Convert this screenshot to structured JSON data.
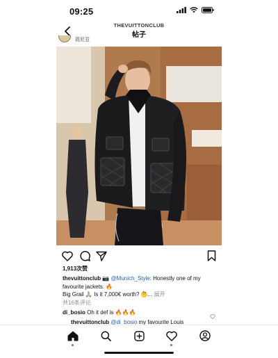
{
  "status_bar": {
    "time": "09:25"
  },
  "header": {
    "account": "THEVUITTONCLUB",
    "title": "帖子"
  },
  "post": {
    "username_partial": "薇尼亚",
    "likes": "1,913次赞",
    "caption": {
      "user": "thevuittonclub",
      "mention": "@Munich_Style",
      "line1_text": ": Honestly one of my favourite jackets. 🔥",
      "line2_text": "Big Grail 🙏🏼 Is it 7,000€ worth? 🤔...",
      "more": "展开"
    },
    "comments_count": "共16条评论",
    "comments": [
      {
        "user": "di_bosio",
        "text": "Oh it def is 🔥🔥🔥"
      },
      {
        "user": "thevuittonclub",
        "mention": "@di_bosio",
        "text": "my favourite Louis"
      }
    ]
  },
  "icons": {
    "back": "chevron-left-icon",
    "like": "heart-icon",
    "comment": "comment-bubble-icon",
    "share": "paper-plane-icon",
    "save": "bookmark-icon",
    "home": "home-icon",
    "search": "search-icon",
    "new_post": "add-post-icon",
    "activity": "heart-icon",
    "profile": "profile-icon"
  },
  "colors": {
    "accent_dot": "#ed4956",
    "mention": "#2a5ca8",
    "muted": "#8e8e8e"
  }
}
